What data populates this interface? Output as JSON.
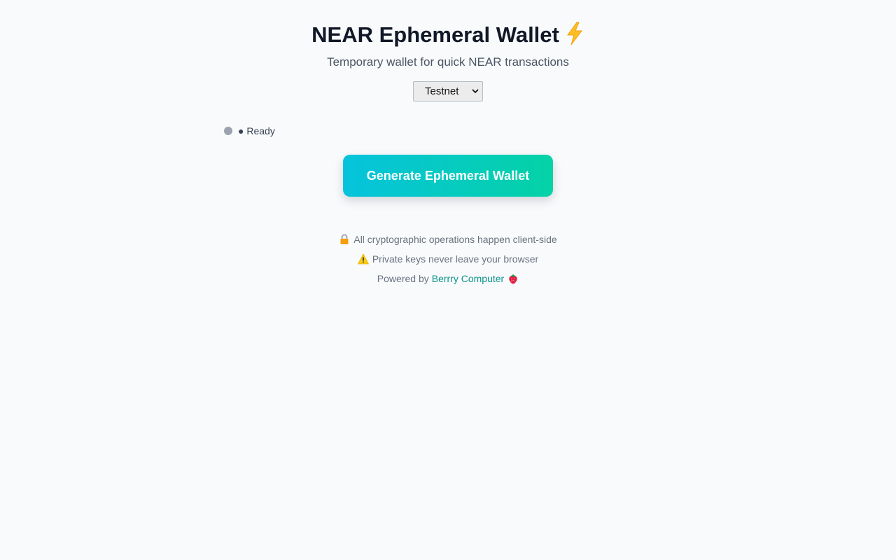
{
  "header": {
    "title": "NEAR Ephemeral Wallet",
    "title_icon": "lightning-bolt-icon",
    "subtitle": "Temporary wallet for quick NEAR transactions"
  },
  "network_select": {
    "selected": "Testnet"
  },
  "status": {
    "text": "● Ready",
    "dot_color": "#9ca3af"
  },
  "actions": {
    "generate_label": "Generate Ephemeral Wallet",
    "gradient_start": "#06c3dc",
    "gradient_end": "#05d2a6"
  },
  "footer": {
    "security_note": "All cryptographic operations happen client-side",
    "security_icon": "lock-icon",
    "warning_note": "Private keys never leave your browser",
    "warning_icon": "warning-icon",
    "powered_prefix": "Powered by",
    "powered_link": "Berrry Computer",
    "powered_icon": "strawberry-icon",
    "link_color": "#0d9488"
  }
}
